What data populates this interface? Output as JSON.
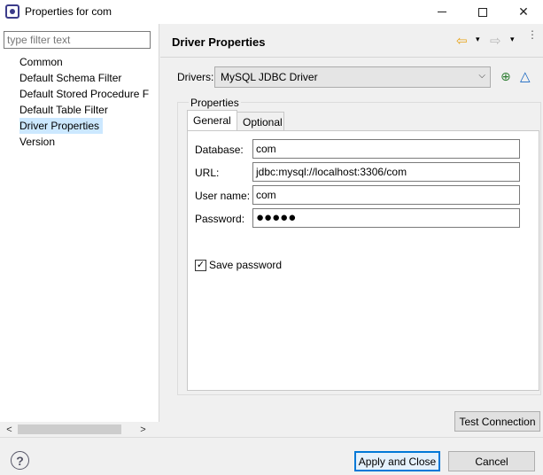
{
  "window": {
    "title": "Properties for com"
  },
  "filter": {
    "placeholder": "type filter text"
  },
  "tree": {
    "items": [
      {
        "label": "Common"
      },
      {
        "label": "Default Schema Filter"
      },
      {
        "label": "Default Stored Procedure F"
      },
      {
        "label": "Default Table Filter"
      },
      {
        "label": "Driver Properties"
      },
      {
        "label": "Version"
      }
    ],
    "selected": "Driver Properties"
  },
  "page": {
    "title": "Driver Properties"
  },
  "drivers": {
    "label": "Drivers:",
    "selected": "MySQL JDBC Driver"
  },
  "properties": {
    "group_label": "Properties",
    "tabs": [
      {
        "label": "General"
      },
      {
        "label": "Optional"
      }
    ],
    "fields": {
      "database": {
        "label": "Database:",
        "value": "com"
      },
      "url": {
        "label": "URL:",
        "value": "jdbc:mysql://localhost:3306/com"
      },
      "username": {
        "label": "User name:",
        "value": "com"
      },
      "password": {
        "label": "Password:",
        "value": "●●●●●"
      }
    },
    "save_password": {
      "label": "Save password",
      "checked": true
    }
  },
  "buttons": {
    "test_connection": "Test Connection",
    "apply_close": "Apply and Close",
    "cancel": "Cancel"
  },
  "icons": {
    "back": "⇦",
    "forward": "⇨",
    "dropdown": "▾",
    "menu": "⋮",
    "add_driver": "⊕",
    "edit_driver": "△",
    "help": "?",
    "check": "✓",
    "scroll_left": "<",
    "scroll_right": ">"
  }
}
